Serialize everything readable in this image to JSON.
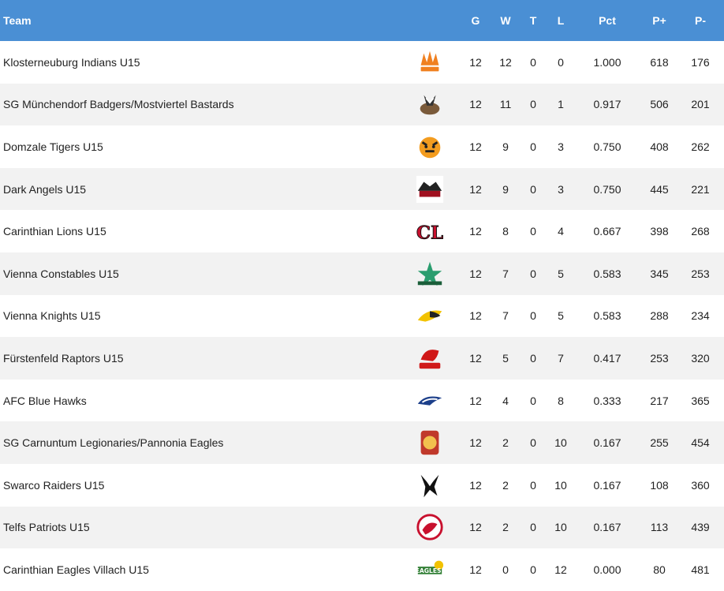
{
  "header": {
    "team": "Team",
    "g": "G",
    "w": "W",
    "t": "T",
    "l": "L",
    "pct": "Pct",
    "pf": "P+",
    "pa": "P-"
  },
  "colors": {
    "header_bg": "#4a8fd4",
    "row_alt": "#f2f2f2"
  },
  "rows": [
    {
      "team": "Klosterneuburg Indians U15",
      "logo": "indians-logo-icon",
      "g": "12",
      "w": "12",
      "t": "0",
      "l": "0",
      "pct": "1.000",
      "pf": "618",
      "pa": "176"
    },
    {
      "team": "SG Münchendorf Badgers/Mostviertel Bastards",
      "logo": "badgers-logo-icon",
      "g": "12",
      "w": "11",
      "t": "0",
      "l": "1",
      "pct": "0.917",
      "pf": "506",
      "pa": "201"
    },
    {
      "team": "Domzale Tigers U15",
      "logo": "tigers-logo-icon",
      "g": "12",
      "w": "9",
      "t": "0",
      "l": "3",
      "pct": "0.750",
      "pf": "408",
      "pa": "262"
    },
    {
      "team": "Dark Angels U15",
      "logo": "dark-angels-logo-icon",
      "g": "12",
      "w": "9",
      "t": "0",
      "l": "3",
      "pct": "0.750",
      "pf": "445",
      "pa": "221"
    },
    {
      "team": "Carinthian Lions U15",
      "logo": "lions-logo-icon",
      "g": "12",
      "w": "8",
      "t": "0",
      "l": "4",
      "pct": "0.667",
      "pf": "398",
      "pa": "268"
    },
    {
      "team": "Vienna Constables U15",
      "logo": "constables-logo-icon",
      "g": "12",
      "w": "7",
      "t": "0",
      "l": "5",
      "pct": "0.583",
      "pf": "345",
      "pa": "253"
    },
    {
      "team": "Vienna Knights U15",
      "logo": "knights-logo-icon",
      "g": "12",
      "w": "7",
      "t": "0",
      "l": "5",
      "pct": "0.583",
      "pf": "288",
      "pa": "234"
    },
    {
      "team": "Fürstenfeld Raptors U15",
      "logo": "raptors-logo-icon",
      "g": "12",
      "w": "5",
      "t": "0",
      "l": "7",
      "pct": "0.417",
      "pf": "253",
      "pa": "320"
    },
    {
      "team": "AFC Blue Hawks",
      "logo": "blue-hawks-logo-icon",
      "g": "12",
      "w": "4",
      "t": "0",
      "l": "8",
      "pct": "0.333",
      "pf": "217",
      "pa": "365"
    },
    {
      "team": "SG Carnuntum Legionaries/Pannonia Eagles",
      "logo": "legionaries-logo-icon",
      "g": "12",
      "w": "2",
      "t": "0",
      "l": "10",
      "pct": "0.167",
      "pf": "255",
      "pa": "454"
    },
    {
      "team": "Swarco Raiders U15",
      "logo": "raiders-logo-icon",
      "g": "12",
      "w": "2",
      "t": "0",
      "l": "10",
      "pct": "0.167",
      "pf": "108",
      "pa": "360"
    },
    {
      "team": "Telfs Patriots U15",
      "logo": "patriots-logo-icon",
      "g": "12",
      "w": "2",
      "t": "0",
      "l": "10",
      "pct": "0.167",
      "pf": "113",
      "pa": "439"
    },
    {
      "team": "Carinthian Eagles Villach U15",
      "logo": "eagles-logo-icon",
      "g": "12",
      "w": "0",
      "t": "0",
      "l": "12",
      "pct": "0.000",
      "pf": "80",
      "pa": "481"
    }
  ]
}
